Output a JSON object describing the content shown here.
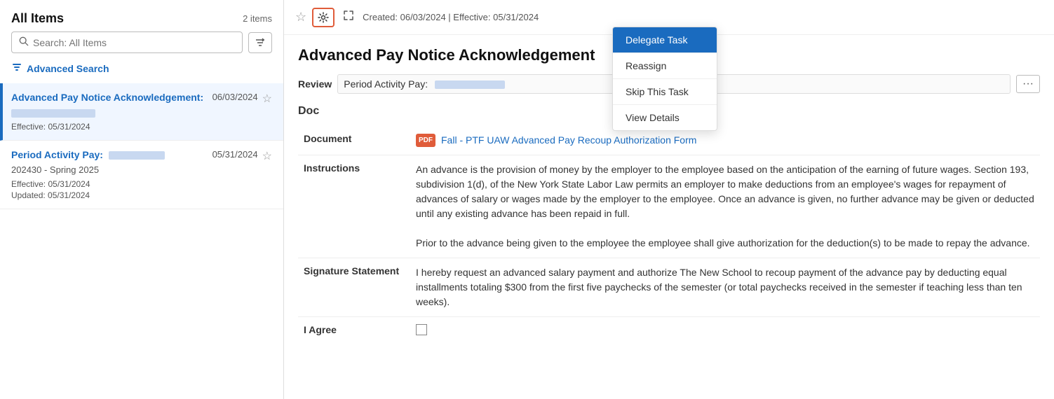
{
  "leftPanel": {
    "title": "All Items",
    "itemsCount": "2 items",
    "search": {
      "placeholder": "Search: All Items"
    },
    "advancedSearch": "Advanced Search",
    "items": [
      {
        "id": "item-1",
        "title": "Advanced Pay Notice Acknowledgement:",
        "subtitle_redacted": true,
        "date": "06/03/2024",
        "effective": "Effective: 05/31/2024",
        "active": true
      },
      {
        "id": "item-2",
        "title": "Period Activity Pay:",
        "subtitle": "202430 - Spring 2025",
        "date": "05/31/2024",
        "effective": "Effective: 05/31/2024",
        "updated": "Updated: 05/31/2024",
        "active": false
      }
    ]
  },
  "rightPanel": {
    "meta": "Created: 06/03/2024 | Effective: 05/31/2024",
    "title": "Advanced Pay Notice Acknowledgement",
    "reviewLabel": "Review",
    "reviewValue": "Period Activity Pay:",
    "documentSectionTitle": "Doc",
    "fields": [
      {
        "label": "Document",
        "type": "link",
        "linkText": "Fall - PTF UAW Advanced Pay Recoup Authorization Form"
      },
      {
        "label": "Instructions",
        "type": "text",
        "value": "An advance is the provision of money by the employer to the employee based on the anticipation of the earning of future wages. Section 193, subdivision 1(d), of the New York State Labor Law permits an employer to make deductions from an employee's wages for repayment of advances of salary or wages made by the employer to the employee.  Once an advance is given, no further advance may be given or deducted until any existing advance has been repaid in full.\n\nPrior to the advance being given to the employee the employee shall give authorization for the deduction(s) to be made to repay the advance."
      },
      {
        "label": "Signature Statement",
        "type": "text",
        "value": "I hereby request an advanced salary payment and authorize The New School to recoup payment of the advance pay by deducting equal installments totaling $300 from the first five paychecks of the semester (or total paychecks received in the semester if teaching less than ten weeks)."
      },
      {
        "label": "I Agree",
        "type": "checkbox"
      }
    ]
  },
  "dropdown": {
    "items": [
      {
        "label": "Delegate Task",
        "active": true
      },
      {
        "label": "Reassign",
        "active": false
      },
      {
        "label": "Skip This Task",
        "active": false
      },
      {
        "label": "View Details",
        "active": false
      }
    ]
  }
}
